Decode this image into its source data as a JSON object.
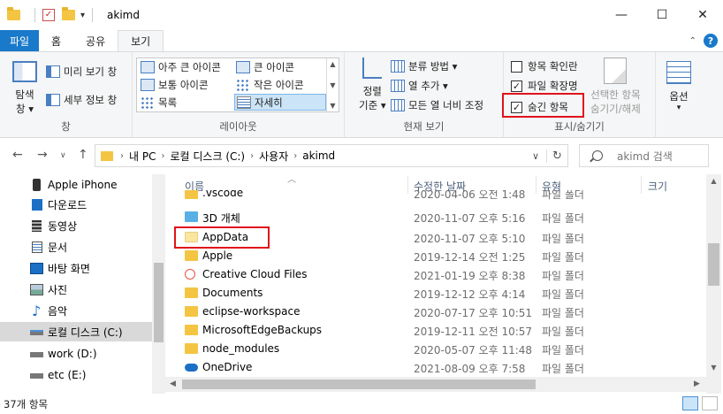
{
  "window": {
    "title": "akimd"
  },
  "tabs": [
    {
      "label": "파일"
    },
    {
      "label": "홈"
    },
    {
      "label": "공유"
    },
    {
      "label": "보기"
    }
  ],
  "ribbon": {
    "pane": {
      "nav_pane_label_1": "탐색",
      "nav_pane_label_2": "창",
      "preview_pane": "미리 보기 창",
      "details_pane": "세부 정보 창",
      "group_label": "창"
    },
    "layout": {
      "items": [
        "아주 큰 아이콘",
        "큰 아이콘",
        "보통 아이콘",
        "작은 아이콘",
        "목록",
        "자세히"
      ],
      "group_label": "레이아웃"
    },
    "current_view": {
      "sort_label_1": "정렬",
      "sort_label_2": "기준",
      "group_by": "분류 방법",
      "add_columns": "열 추가",
      "size_all_columns": "모든 열 너비 조정",
      "group_label": "현재 보기"
    },
    "show_hide": {
      "item_checkboxes": "항목 확인란",
      "file_extensions": "파일 확장명",
      "hidden_items": "숨긴 항목",
      "hide_selected_1": "선택한 항목",
      "hide_selected_2": "숨기기/해제",
      "group_label": "표시/숨기기"
    },
    "options": {
      "label": "옵션"
    }
  },
  "address": {
    "crumbs": [
      "내 PC",
      "로컬 디스크 (C:)",
      "사용자",
      "akimd"
    ],
    "search_placeholder": "akimd 검색"
  },
  "navpane": {
    "items": [
      {
        "label": "Apple iPhone",
        "icon": "phone-icon"
      },
      {
        "label": "다운로드",
        "icon": "download-icon"
      },
      {
        "label": "동영상",
        "icon": "video-icon"
      },
      {
        "label": "문서",
        "icon": "document-icon"
      },
      {
        "label": "바탕 화면",
        "icon": "desktop-icon"
      },
      {
        "label": "사진",
        "icon": "pictures-icon"
      },
      {
        "label": "음악",
        "icon": "music-icon"
      },
      {
        "label": "로컬 디스크 (C:)",
        "icon": "drive-icon"
      },
      {
        "label": "work (D:)",
        "icon": "drive-icon"
      },
      {
        "label": "etc (E:)",
        "icon": "drive-icon"
      }
    ]
  },
  "filelist": {
    "columns": {
      "name": "이름",
      "date": "수정한 날짜",
      "type": "유형",
      "size": "크기"
    },
    "rows": [
      {
        "name": ".vscode",
        "date": "2020-04-06 오전 1:48",
        "type": "파일 폴더"
      },
      {
        "name": "3D 개체",
        "date": "2020-11-07 오후 5:16",
        "type": "파일 폴더"
      },
      {
        "name": "AppData",
        "date": "2020-11-07 오후 5:10",
        "type": "파일 폴더"
      },
      {
        "name": "Apple",
        "date": "2019-12-14 오전 1:25",
        "type": "파일 폴더"
      },
      {
        "name": "Creative Cloud Files",
        "date": "2021-01-19 오후 8:38",
        "type": "파일 폴더"
      },
      {
        "name": "Documents",
        "date": "2019-12-12 오후 4:14",
        "type": "파일 폴더"
      },
      {
        "name": "eclipse-workspace",
        "date": "2020-07-17 오후 10:51",
        "type": "파일 폴더"
      },
      {
        "name": "MicrosoftEdgeBackups",
        "date": "2019-12-11 오전 10:57",
        "type": "파일 폴더"
      },
      {
        "name": "node_modules",
        "date": "2020-05-07 오후 11:48",
        "type": "파일 폴더"
      },
      {
        "name": "OneDrive",
        "date": "2021-08-09 오후 7:58",
        "type": "파일 폴더"
      }
    ]
  },
  "status": {
    "item_count": "37개 항목"
  },
  "colors": {
    "accent": "#1979ca",
    "highlight": "#e0121b"
  }
}
